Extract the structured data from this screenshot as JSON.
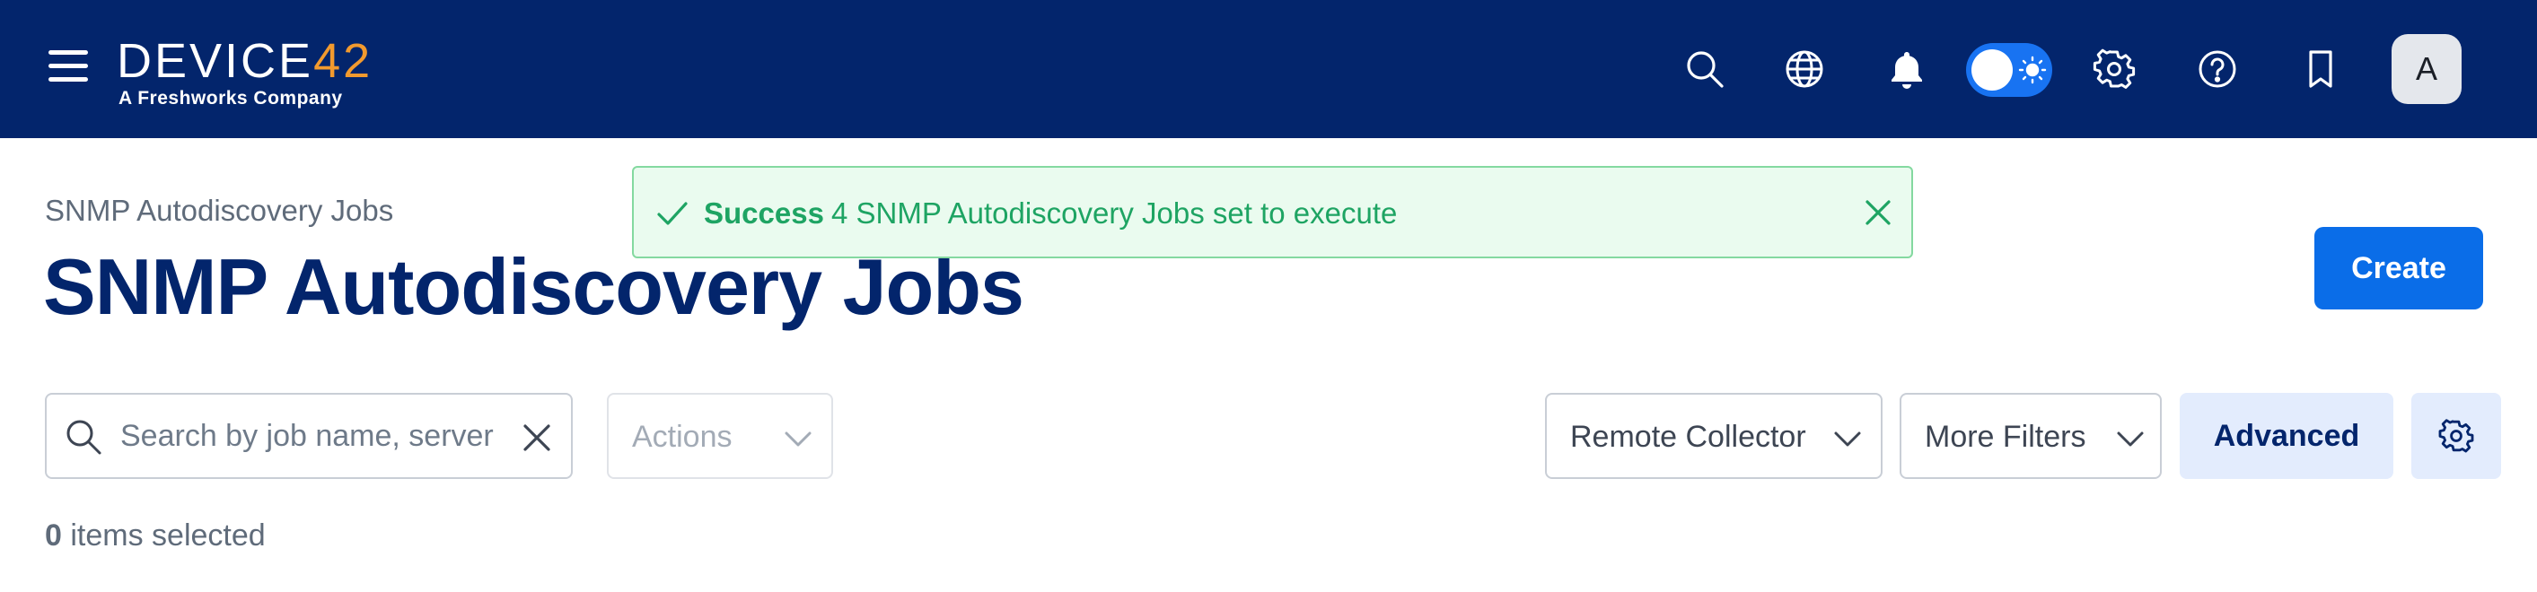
{
  "topbar": {
    "logo_text_main": "DEVICE",
    "logo_text_num": "42",
    "logo_subtitle": "A Freshworks Company",
    "avatar_initial": "A",
    "icons": [
      "menu-icon",
      "search-icon",
      "globe-icon",
      "bell-icon",
      "theme-toggle-sun-icon",
      "gear-icon",
      "help-icon",
      "bookmark-icon"
    ],
    "background_color": "#03256c",
    "logo_accent_color": "#f29a2e"
  },
  "header": {
    "breadcrumb": "SNMP Autodiscovery Jobs",
    "title": "SNMP Autodiscovery Jobs",
    "create_label": "Create"
  },
  "toast": {
    "title": "Success",
    "message": "4 SNMP Autodiscovery Jobs set to execute",
    "color": "#1ea463"
  },
  "filters": {
    "search_placeholder": "Search by job name, server",
    "actions_label": "Actions",
    "remote_collector_label": "Remote Collector",
    "more_filters_label": "More Filters",
    "advanced_label": "Advanced"
  },
  "selection": {
    "count": "0",
    "suffix": " items selected"
  },
  "colors": {
    "primary_button": "#0a6de8",
    "secondary_button_bg": "#e3ecfd"
  }
}
